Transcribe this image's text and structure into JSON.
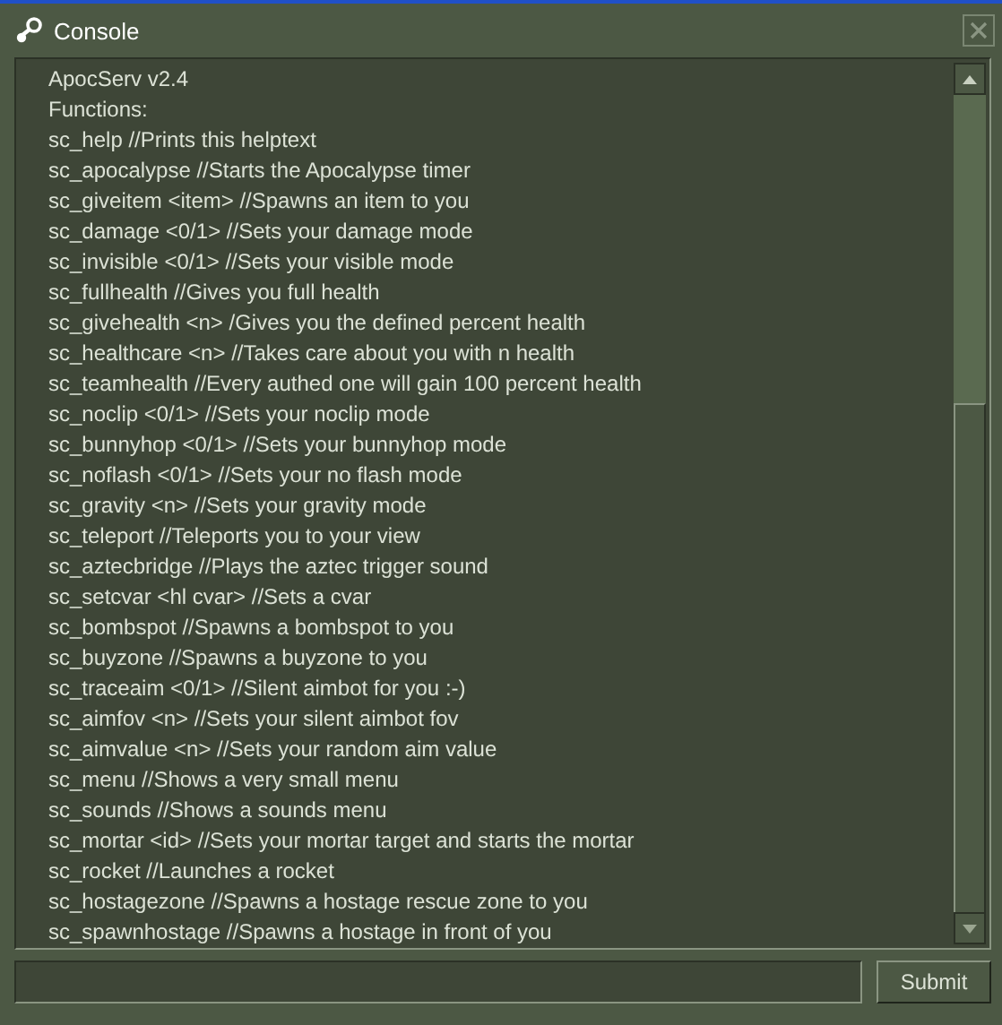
{
  "window": {
    "title": "Console"
  },
  "console": {
    "lines": [
      "ApocServ v2.4",
      "Functions:",
      "sc_help //Prints this helptext",
      "sc_apocalypse //Starts the Apocalypse timer",
      "sc_giveitem <item> //Spawns an item to you",
      "sc_damage <0/1> //Sets your damage mode",
      "sc_invisible <0/1> //Sets your visible mode",
      "sc_fullhealth //Gives you full health",
      "sc_givehealth <n> /Gives you the defined percent health",
      "sc_healthcare <n> //Takes care about you with n health",
      "sc_teamhealth //Every authed one will gain 100 percent health",
      "sc_noclip <0/1> //Sets your noclip mode",
      "sc_bunnyhop <0/1> //Sets your bunnyhop mode",
      "sc_noflash <0/1> //Sets your no flash mode",
      "sc_gravity <n> //Sets your gravity mode",
      "sc_teleport //Teleports you to your view",
      "sc_aztecbridge //Plays the aztec trigger sound",
      "sc_setcvar <hl cvar> //Sets a cvar",
      "sc_bombspot //Spawns a bombspot to you",
      "sc_buyzone //Spawns a buyzone to you",
      "sc_traceaim <0/1> //Silent aimbot for you :-)",
      "sc_aimfov <n> //Sets your silent aimbot fov",
      "sc_aimvalue <n> //Sets your random aim value",
      "sc_menu //Shows a very small menu",
      "sc_sounds //Shows a sounds menu",
      "sc_mortar <id> //Sets your mortar target and starts the mortar",
      "sc_rocket //Launches a rocket",
      "sc_hostagezone //Spawns a hostage rescue zone to you",
      "sc_spawnhostage //Spawns a hostage in front of you"
    ]
  },
  "submit_button": {
    "label": "Submit"
  }
}
